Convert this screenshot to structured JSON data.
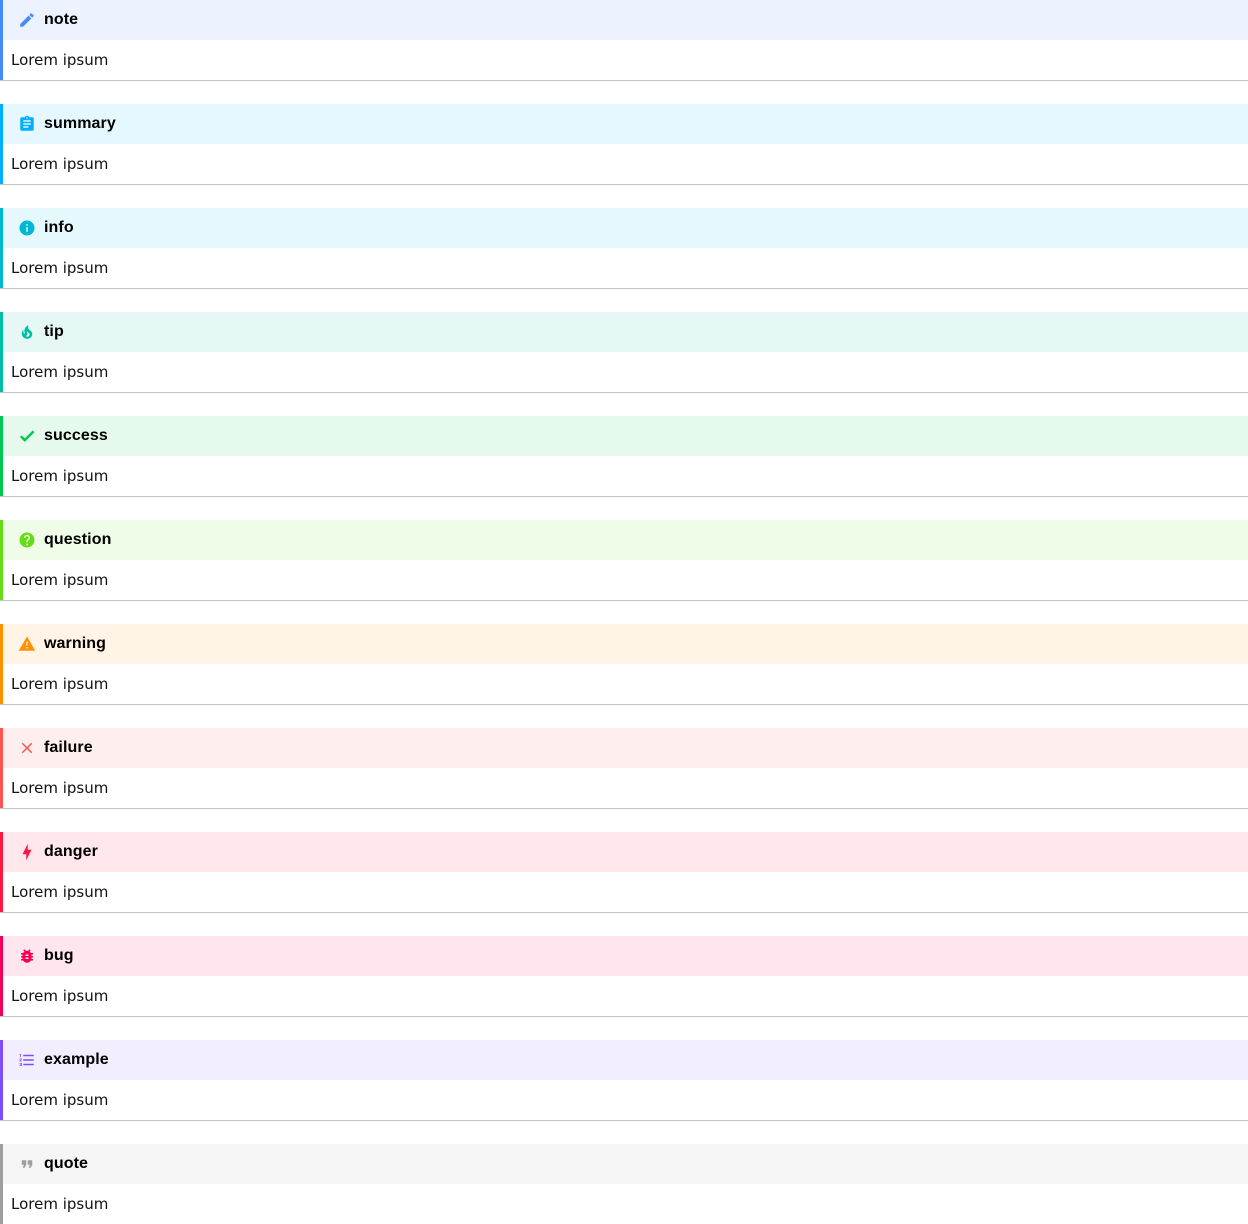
{
  "admonitions": [
    {
      "title": "note",
      "body": "Lorem ipsum",
      "icon": "pencil-icon",
      "color": "#448aff",
      "bg": "#ecf3ff"
    },
    {
      "title": "summary",
      "body": "Lorem ipsum",
      "icon": "clipboard-icon",
      "color": "#00b0ff",
      "bg": "#e5f7ff"
    },
    {
      "title": "info",
      "body": "Lorem ipsum",
      "icon": "info-circle-icon",
      "color": "#00b8d4",
      "bg": "#e5f8fb"
    },
    {
      "title": "tip",
      "body": "Lorem ipsum",
      "icon": "flame-icon",
      "color": "#00bfa5",
      "bg": "#e5f8f6"
    },
    {
      "title": "success",
      "body": "Lorem ipsum",
      "icon": "check-icon",
      "color": "#00c853",
      "bg": "#e5f9ed"
    },
    {
      "title": "question",
      "body": "Lorem ipsum",
      "icon": "question-circle-icon",
      "color": "#64dd17",
      "bg": "#effce7"
    },
    {
      "title": "warning",
      "body": "Lorem ipsum",
      "icon": "warning-triangle-icon",
      "color": "#ff9100",
      "bg": "#fff4e5"
    },
    {
      "title": "failure",
      "body": "Lorem ipsum",
      "icon": "close-icon",
      "color": "#ff5252",
      "bg": "#ffeeee"
    },
    {
      "title": "danger",
      "body": "Lorem ipsum",
      "icon": "lightning-icon",
      "color": "#ff1744",
      "bg": "#ffe7ec"
    },
    {
      "title": "bug",
      "body": "Lorem ipsum",
      "icon": "bug-icon",
      "color": "#f50057",
      "bg": "#fee5ee"
    },
    {
      "title": "example",
      "body": "Lorem ipsum",
      "icon": "list-icon",
      "color": "#7c4dff",
      "bg": "#f2edff"
    },
    {
      "title": "quote",
      "body": "Lorem ipsum",
      "icon": "quote-icon",
      "color": "#9e9e9e",
      "bg": "#f5f5f5"
    }
  ]
}
